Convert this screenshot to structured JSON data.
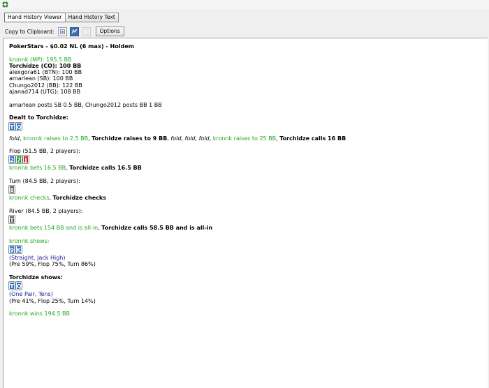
{
  "toolbar": {
    "tabs": [
      "Hand History Viewer",
      "Hand History Text"
    ],
    "copy_label": "Copy to Clipboard:",
    "options_label": "Options"
  },
  "colors": {
    "hero": "#000000",
    "villain": "#22a522",
    "hand_name": "#1a1aa0",
    "card_blue": "#1f6fd6",
    "card_green": "#1e9a30",
    "card_red": "#d42b1f",
    "card_gray": "#505050"
  },
  "hand": {
    "header": "PokerStars - $0.02 NL (6 max) - Holdem",
    "seats": [
      {
        "text": "kronnk (MP): 195.5 BB",
        "style": "g"
      },
      {
        "text": "Torchidze (CO): 100 BB",
        "style": "b"
      },
      {
        "text": "alexgora61 (BTN): 100 BB",
        "style": ""
      },
      {
        "text": "amarlean (SB): 100 BB",
        "style": ""
      },
      {
        "text": "Chungo2012 (BB): 122 BB",
        "style": ""
      },
      {
        "text": "ajanad714 (UTG): 108 BB",
        "style": ""
      }
    ],
    "blinds": "amarlean posts SB 0.5 BB, Chungo2012 posts BB 1 BB",
    "dealt_label": "Dealt to Torchidze:",
    "dealt_cards": [
      {
        "rank": "T",
        "color": "blue"
      },
      {
        "rank": "Q",
        "color": "blue"
      }
    ],
    "preflop": [
      {
        "t": "fold",
        "s": "i"
      },
      {
        "t": ", ",
        "s": ""
      },
      {
        "t": "kronnk raises to 2.5 BB",
        "s": "g"
      },
      {
        "t": ", ",
        "s": ""
      },
      {
        "t": "Torchidze raises to 9 BB",
        "s": "b"
      },
      {
        "t": ", ",
        "s": ""
      },
      {
        "t": "fold",
        "s": "i"
      },
      {
        "t": ", ",
        "s": ""
      },
      {
        "t": "fold",
        "s": "i"
      },
      {
        "t": ", ",
        "s": ""
      },
      {
        "t": "fold",
        "s": "i"
      },
      {
        "t": ", ",
        "s": ""
      },
      {
        "t": "kronnk raises to 25 BB",
        "s": "g"
      },
      {
        "t": ", ",
        "s": ""
      },
      {
        "t": "Torchidze calls 16 BB",
        "s": "b"
      }
    ],
    "flop_label": "Flop (51.5 BB, 2 players):",
    "flop_cards": [
      {
        "rank": "2",
        "color": "blue"
      },
      {
        "rank": "7",
        "color": "green"
      },
      {
        "rank": "J",
        "color": "red"
      }
    ],
    "flop_actions": [
      {
        "t": "kronnk bets 16.5 BB",
        "s": "g"
      },
      {
        "t": ", ",
        "s": ""
      },
      {
        "t": "Torchidze calls 16.5 BB",
        "s": "b"
      }
    ],
    "turn_label": "Turn (84.5 BB, 2 players):",
    "turn_cards": [
      {
        "rank": "8",
        "color": "gray"
      }
    ],
    "turn_actions": [
      {
        "t": "kronnk checks",
        "s": "g"
      },
      {
        "t": ", ",
        "s": ""
      },
      {
        "t": "Torchidze checks",
        "s": "b"
      }
    ],
    "river_label": "River (84.5 BB, 2 players):",
    "river_cards": [
      {
        "rank": "T",
        "color": "gray"
      }
    ],
    "river_actions": [
      {
        "t": "kronnk bets 154 BB and is all-in",
        "s": "g"
      },
      {
        "t": ", ",
        "s": ""
      },
      {
        "t": "Torchidze calls 58.5 BB and is all-in",
        "s": "b"
      }
    ],
    "villain_show_label": "kronnk shows:",
    "villain_cards": [
      {
        "rank": "9",
        "color": "blue"
      },
      {
        "rank": "K",
        "color": "blue"
      }
    ],
    "villain_hand": "(Straight, Jack High)",
    "villain_equity": "(Pre 59%, Flop 75%, Turn 86%)",
    "hero_show_label": "Torchidze shows:",
    "hero_cards": [
      {
        "rank": "T",
        "color": "blue"
      },
      {
        "rank": "Q",
        "color": "blue"
      }
    ],
    "hero_hand": "(One Pair, Tens)",
    "hero_equity": "(Pre 41%, Flop 25%, Turn 14%)",
    "result": "kronnk wins 194.5 BB"
  }
}
